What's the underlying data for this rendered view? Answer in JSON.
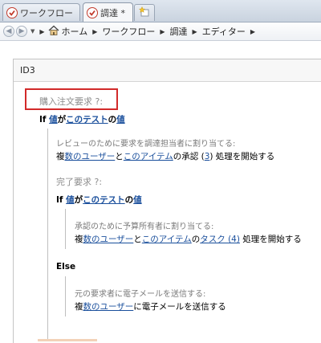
{
  "tabs": [
    {
      "label": "ワークフロー",
      "icon": "workflow-icon"
    },
    {
      "label": "調達 *",
      "icon": "workflow-icon"
    }
  ],
  "new_tab_icon": "new-tab-star-icon",
  "breadcrumb": {
    "items": [
      "ホーム",
      "ワークフロー",
      "調達",
      "エディター"
    ]
  },
  "panel": {
    "id_label": "ID3"
  },
  "editor": {
    "step1_title": "購入注文要求 ?:",
    "if1": {
      "prefix": "If ",
      "value1": "値",
      "ga": "が",
      "test": "このテスト",
      "no": "の",
      "value2": "値"
    },
    "step1_desc": "レビューのために要求を調達担当者に割り当てる:",
    "step1_action": {
      "prefix": "複",
      "users": "数のユーザー",
      "to": "と",
      "item": "このアイテム",
      "mid": "の承認 (",
      "num": "3",
      "suffix": ") 処理を開始する"
    },
    "step2_title": "完了要求 ?:",
    "if2": {
      "prefix": "If ",
      "value1": "値",
      "ga": "が",
      "test": "このテスト",
      "no": "の",
      "value2": "値"
    },
    "step2_desc": "承認のために予算所有者に割り当てる:",
    "step2_action": {
      "prefix": "複",
      "users": "数のユーザー",
      "to": "と",
      "item": "このアイテム",
      "mid": "の",
      "task": "タスク (4)",
      "suffix": " 処理を開始する"
    },
    "else_label": "Else",
    "step3_desc": "元の要求者に電子メールを送信する:",
    "step3_action": {
      "prefix": "複",
      "users": "数のユーザー",
      "suffix": "に電子メールを送信する"
    }
  },
  "colors": {
    "link": "#1a4f9c",
    "highlight_box": "#d22a2a",
    "muted": "#8c8c8c"
  }
}
